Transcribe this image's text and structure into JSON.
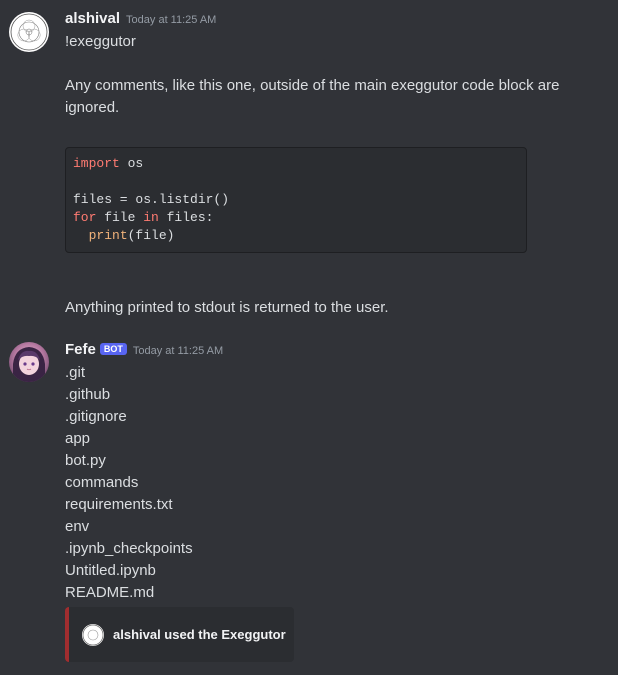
{
  "messages": [
    {
      "username": "alshival",
      "timestamp": "Today at 11:25 AM",
      "command": "!exeggutor",
      "comment": "Any comments, like this one, outside of the main exeggutor code block are ignored.",
      "code": {
        "l1_kw": "import",
        "l1_rest": " os",
        "l3": "files = os.listdir()",
        "l4_kw1": "for",
        "l4_mid": " file ",
        "l4_kw2": "in",
        "l4_rest": " files:",
        "l5_indent": "  ",
        "l5_fn": "print",
        "l5_rest": "(file)"
      },
      "footer": "Anything printed to stdout is returned to the user."
    },
    {
      "username": "Fefe",
      "badge": "BOT",
      "timestamp": "Today at 11:25 AM",
      "output_lines": [
        ".git",
        ".github",
        ".gitignore",
        "app",
        "bot.py",
        "commands",
        "requirements.txt",
        "env",
        ".ipynb_checkpoints",
        "Untitled.ipynb",
        "README.md"
      ],
      "embed_text": "alshival used the Exeggutor"
    }
  ]
}
